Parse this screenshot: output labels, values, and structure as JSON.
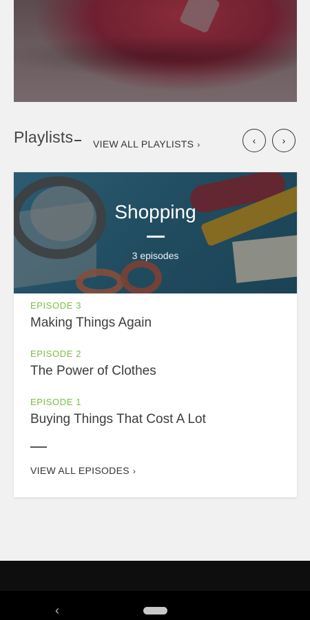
{
  "section": {
    "title": "Playlists",
    "view_all_label": "VIEW ALL PLAYLISTS",
    "chevron": "›",
    "prev_icon": "‹",
    "next_icon": "›"
  },
  "playlist": {
    "name": "Shopping",
    "episode_count": "3 episodes",
    "episodes": [
      {
        "label": "EPISODE 3",
        "title": "Making Things Again"
      },
      {
        "label": "EPISODE 2",
        "title": "The Power of Clothes"
      },
      {
        "label": "EPISODE 1",
        "title": "Buying Things That Cost A Lot"
      }
    ],
    "view_all_label": "VIEW ALL EPISODES"
  },
  "system_nav": {
    "back_icon": "‹"
  },
  "colors": {
    "accent": "#78bd45",
    "background": "#f1f1f1",
    "card": "#ffffff"
  }
}
